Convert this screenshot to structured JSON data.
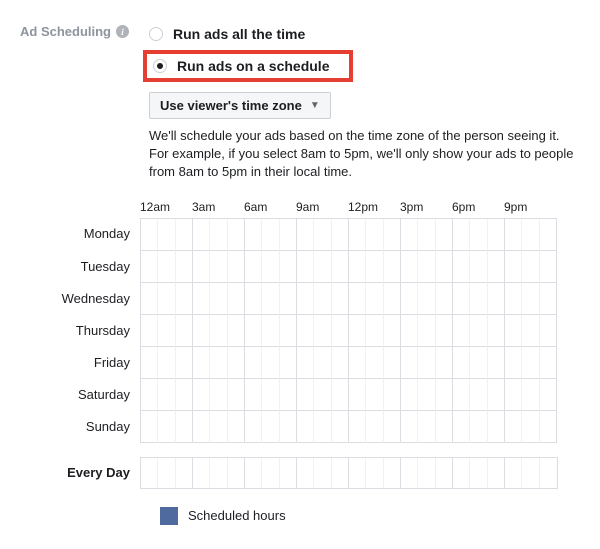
{
  "section": {
    "label": "Ad Scheduling"
  },
  "radios": {
    "all_time": "Run ads all the time",
    "on_schedule": "Run ads on a schedule"
  },
  "dropdown": {
    "selected": "Use viewer's time zone"
  },
  "help": {
    "line1": "We'll schedule your ads based on the time zone of the person seeing it.",
    "line2": "For example, if you select 8am to 5pm, we'll only show your ads to people from 8am to 5pm in their local time."
  },
  "schedule": {
    "hours": [
      "12am",
      "3am",
      "6am",
      "9am",
      "12pm",
      "3pm",
      "6pm",
      "9pm"
    ],
    "days": [
      "Monday",
      "Tuesday",
      "Wednesday",
      "Thursday",
      "Friday",
      "Saturday",
      "Sunday"
    ],
    "everyday_label": "Every Day"
  },
  "legend": {
    "scheduled": "Scheduled hours"
  },
  "colors": {
    "legend_swatch": "#4e6a9e",
    "highlight_border": "#e63f32"
  }
}
